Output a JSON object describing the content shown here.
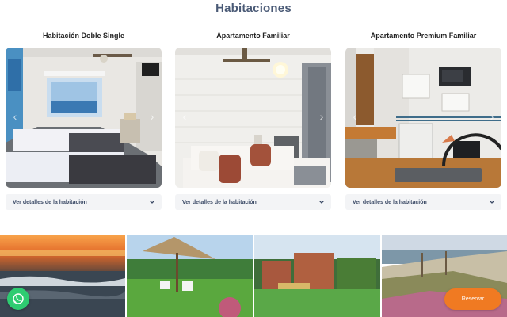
{
  "section": {
    "title": "Habitaciones"
  },
  "rooms": [
    {
      "title": "Habitación Doble Single",
      "details_label": "Ver detalles de la habitación"
    },
    {
      "title": "Apartamento Familiar",
      "details_label": "Ver detalles de la habitación"
    },
    {
      "title": "Apartamento Premium Familiar",
      "details_label": "Ver detalles de la habitación"
    }
  ],
  "carousel": {
    "prev_icon": "chevron-left-icon",
    "next_icon": "chevron-right-icon"
  },
  "gallery": {
    "items": [
      "sunset-sea",
      "garden-umbrella",
      "hotel-building",
      "dunes-beach"
    ]
  },
  "floating": {
    "whatsapp_icon": "whatsapp-icon",
    "reserve_label": "Reservar"
  },
  "colors": {
    "title": "#4a5a76",
    "accent": "#f07a22",
    "whatsapp": "#2ecc71",
    "toggle_bg": "#f3f4f6"
  }
}
